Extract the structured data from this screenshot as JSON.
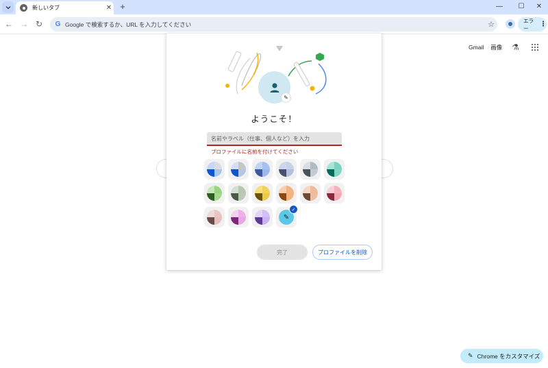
{
  "tabstrip": {
    "tab_title": "新しいタブ",
    "close_glyph": "✕",
    "new_tab_glyph": "+",
    "minimize_glyph": "—",
    "maximize_glyph": "☐",
    "close_window_glyph": "✕"
  },
  "toolbar": {
    "back_glyph": "←",
    "forward_glyph": "→",
    "reload_glyph": "↻",
    "omnibox_text": "Google で検索するか、URL を入力してください",
    "star_glyph": "☆",
    "error_chip_label": "エラー",
    "menu_glyph": "⋮"
  },
  "ntp": {
    "gmail_label": "Gmail",
    "images_label": "画像",
    "customize_label": "Chrome をカスタマイズ"
  },
  "dialog": {
    "welcome_title": "ようこそ！",
    "name_placeholder": "名前やラベル（仕事、個人など）を入力",
    "name_value": "",
    "error_message": "プロファイルに名前を付けてください",
    "done_label": "完了",
    "delete_label": "プロファイルを削除",
    "swatches": [
      {
        "top": "#c5d8f6",
        "mid": "#a9c4ee",
        "bottom": "#0b57d0",
        "br": "#dadce0"
      },
      {
        "top": "#d3dff5",
        "mid": "#b5c6e6",
        "bottom": "#0b57d0",
        "br": "#c4c7c5"
      },
      {
        "top": "#c2d3f5",
        "mid": "#9fb8ec",
        "bottom": "#3c5b9c",
        "br": "#a8c0f0"
      },
      {
        "top": "#cdd6ee",
        "mid": "#b4bfdc",
        "bottom": "#475273",
        "br": "#c9d1e6"
      },
      {
        "top": "#d9dee3",
        "mid": "#c3cad0",
        "bottom": "#4a5257",
        "br": "#aebbc3"
      },
      {
        "top": "#a5e5d7",
        "mid": "#7fd6c3",
        "bottom": "#016a5c",
        "br": "#7ad3c0"
      },
      {
        "top": "#c4e8b8",
        "mid": "#a3da90",
        "bottom": "#2f5e22",
        "br": "#9ad47f"
      },
      {
        "top": "#d5dfd2",
        "mid": "#bcc9b7",
        "bottom": "#4d5a48",
        "br": "#b8c7b2"
      },
      {
        "top": "#f6df7a",
        "mid": "#eccb4a",
        "bottom": "#6a5404",
        "br": "#efd25a"
      },
      {
        "top": "#f8cfae",
        "mid": "#f3b383",
        "bottom": "#8a4a0c",
        "br": "#f3b283"
      },
      {
        "top": "#f6d6c3",
        "mid": "#eebd9f",
        "bottom": "#6e4b36",
        "br": "#edbb9c"
      },
      {
        "top": "#f8cfd6",
        "mid": "#f2a9b6",
        "bottom": "#8e2640",
        "br": "#f5b1bd"
      },
      {
        "top": "#f2d9d9",
        "mid": "#e6bfbf",
        "bottom": "#6a4a4a",
        "br": "#e9c5c5"
      },
      {
        "top": "#f3cff1",
        "mid": "#e8a7e4",
        "bottom": "#7a2a76",
        "br": "#ecb1e7"
      },
      {
        "top": "#e2d5f6",
        "mid": "#c9b3ee",
        "bottom": "#5b3b96",
        "br": "#d2befa"
      },
      {
        "top": "custom",
        "mid": "",
        "bottom": "",
        "br": ""
      }
    ]
  },
  "colors": {
    "accent": "#0b57d0",
    "error": "#b3261e",
    "tabstrip_bg": "#d3e3fd",
    "avatar_bg": "#cfe8f2",
    "custom_swatch": "#5cc8e8"
  },
  "icons": {
    "tab_search": "chevron-down-icon",
    "favicon": "chrome-icon",
    "avatar": "person-icon",
    "labs": "flask-icon",
    "apps": "grid-icon",
    "edit": "pencil-icon",
    "selected": "checkmark-icon"
  }
}
